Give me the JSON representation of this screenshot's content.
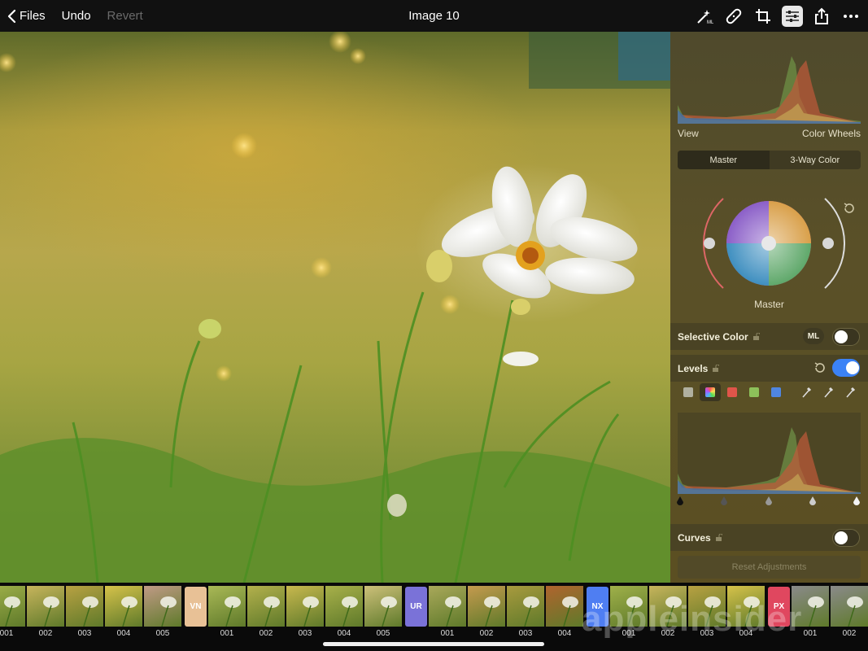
{
  "topbar": {
    "back_label": "Files",
    "undo_label": "Undo",
    "revert_label": "Revert",
    "title": "Image 10",
    "tools": [
      "ml-enhance-icon",
      "bandage-icon",
      "crop-icon",
      "adjust-sliders-icon",
      "share-icon",
      "more-icon"
    ]
  },
  "panel": {
    "view_label": "View",
    "view_mode": "Color Wheels",
    "segments": [
      "Master",
      "3-Way Color"
    ],
    "wheel_label": "Master",
    "selective_color": {
      "label": "Selective Color",
      "badge": "ML",
      "enabled": false
    },
    "levels": {
      "label": "Levels",
      "enabled": true,
      "channels": [
        "gray",
        "rgb",
        "red",
        "green",
        "blue"
      ]
    },
    "curves": {
      "label": "Curves",
      "enabled": false
    },
    "reset_label": "Reset Adjustments"
  },
  "filmstrip": {
    "groups": [
      {
        "tag": "",
        "color": "",
        "items": [
          "001",
          "002",
          "003",
          "004",
          "005"
        ]
      },
      {
        "tag": "VN",
        "color": "#e8c196",
        "items": [
          "001",
          "002",
          "003",
          "004",
          "005"
        ]
      },
      {
        "tag": "UR",
        "color": "#7a72d8",
        "items": [
          "001",
          "002",
          "003",
          "004"
        ]
      },
      {
        "tag": "NX",
        "color": "#4f7ef2",
        "items": [
          "001",
          "002",
          "003",
          "004"
        ]
      },
      {
        "tag": "PX",
        "color": "#e0475f",
        "items": [
          "001",
          "002"
        ]
      }
    ]
  },
  "watermark": "appleinsider",
  "colors": {
    "accent": "#3b82f6",
    "panel": "#5a5028"
  }
}
